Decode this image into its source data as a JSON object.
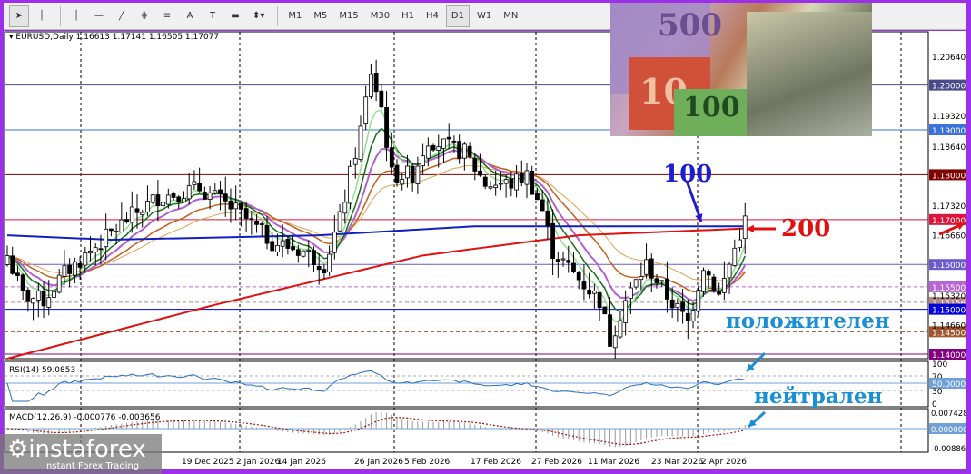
{
  "toolbar": {
    "tools": [
      "cursor-icon",
      "crosshair-icon",
      "vertical-line-icon",
      "horizontal-line-icon",
      "trendline-icon",
      "fibonacci-icon",
      "fibo-levels-icon",
      "text-icon",
      "text-label-icon",
      "rectangle-icon",
      "arrows-icon"
    ],
    "tool_glyphs": [
      "➤",
      "┼",
      "│",
      "—",
      "╱",
      "⋕",
      "≡",
      "A",
      "T",
      "▬",
      "⬍▾"
    ],
    "timeframes": [
      "M1",
      "M5",
      "M15",
      "M30",
      "H1",
      "H4",
      "D1",
      "W1",
      "MN"
    ],
    "active_timeframe": "D1"
  },
  "header": {
    "symbol": "EURUSD,Daily",
    "ohlc": "1.16613 1.17141 1.16505 1.17077"
  },
  "photo": {
    "notes": [
      "500",
      "10",
      "100"
    ]
  },
  "price_axis": {
    "labels": [
      "1.20640",
      "1.19320",
      "1.18640",
      "1.17320",
      "1.16660",
      "1.15320",
      "1.14660"
    ],
    "levels": [
      {
        "price": 1.2,
        "label": "1.20000",
        "color": "#4b4a8c",
        "dash": false
      },
      {
        "price": 1.19,
        "label": "1.19000",
        "color": "#3b72d9",
        "dash": false
      },
      {
        "price": 1.18,
        "label": "1.18000",
        "color": "#800000",
        "dash": false
      },
      {
        "price": 1.17,
        "label": "1.17000",
        "color": "#dc143c",
        "dash": false
      },
      {
        "price": 1.16,
        "label": "1.16000",
        "color": "#6a5acd",
        "dash": false
      },
      {
        "price": 1.155,
        "label": "1.15500",
        "color": "#b865d6",
        "dash": true
      },
      {
        "price": 1.15156,
        "label": "1.15156",
        "color": "#b08a86",
        "dash": true
      },
      {
        "price": 1.15,
        "label": "1.15000",
        "color": "#0000dd",
        "dash": false
      },
      {
        "price": 1.145,
        "label": "1.14500",
        "color": "#a0552d",
        "dash": true
      },
      {
        "price": 1.14,
        "label": "1.14000",
        "color": "#800080",
        "dash": false
      }
    ]
  },
  "dates": [
    "19 Dec 2025",
    "2 Jan 2026",
    "14 Jan 2026",
    "26 Jan 2026",
    "5 Feb 2026",
    "17 Feb 2026",
    "27 Feb 2026",
    "11 Mar 2026",
    "23 Mar 2026",
    "2 Apr 2026"
  ],
  "rsi": {
    "label": "RSI(14) 59.0853",
    "levels": [
      "100",
      "70",
      "50.0000",
      "30",
      "0"
    ]
  },
  "macd": {
    "label": "MACD(12,26,9) -0.000776 -0.003656",
    "levels": [
      "0.007428",
      "0.000000",
      "-0.008862"
    ]
  },
  "annotations": {
    "ma100": "100",
    "ma200": "200",
    "rsi_note": "положителен",
    "macd_note": "нейтрален"
  },
  "logo": {
    "name": "instaforex",
    "tagline": "Instant Forex Trading"
  },
  "chart_data": {
    "type": "candlestick",
    "symbol": "EURUSD",
    "timeframe": "Daily",
    "ylim": [
      1.138,
      1.212
    ],
    "price_path": [
      [
        0,
        1.162
      ],
      [
        3,
        1.153
      ],
      [
        7,
        1.152
      ],
      [
        11,
        1.158
      ],
      [
        16,
        1.163
      ],
      [
        23,
        1.17
      ],
      [
        29,
        1.175
      ],
      [
        37,
        1.177
      ],
      [
        44,
        1.172
      ],
      [
        51,
        1.165
      ],
      [
        57,
        1.163
      ],
      [
        61,
        1.16
      ],
      [
        64,
        1.17
      ],
      [
        66,
        1.18
      ],
      [
        68,
        1.19
      ],
      [
        70,
        1.203
      ],
      [
        72,
        1.195
      ],
      [
        74,
        1.18
      ],
      [
        78,
        1.18
      ],
      [
        81,
        1.188
      ],
      [
        85,
        1.186
      ],
      [
        88,
        1.185
      ],
      [
        92,
        1.178
      ],
      [
        97,
        1.178
      ],
      [
        100,
        1.18
      ],
      [
        103,
        1.172
      ],
      [
        105,
        1.163
      ],
      [
        109,
        1.158
      ],
      [
        114,
        1.152
      ],
      [
        116,
        1.143
      ],
      [
        119,
        1.152
      ],
      [
        123,
        1.16
      ],
      [
        127,
        1.153
      ],
      [
        131,
        1.147
      ],
      [
        134,
        1.16
      ],
      [
        137,
        1.153
      ],
      [
        139,
        1.16
      ],
      [
        141,
        1.167
      ],
      [
        142,
        1.1708
      ]
    ],
    "ma100_path": [
      [
        0,
        1.1665
      ],
      [
        20,
        1.1655
      ],
      [
        60,
        1.1665
      ],
      [
        90,
        1.1685
      ],
      [
        120,
        1.1685
      ],
      [
        142,
        1.1685
      ]
    ],
    "ma200_path": [
      [
        0,
        1.139
      ],
      [
        40,
        1.151
      ],
      [
        80,
        1.162
      ],
      [
        110,
        1.1665
      ],
      [
        142,
        1.168
      ]
    ]
  }
}
